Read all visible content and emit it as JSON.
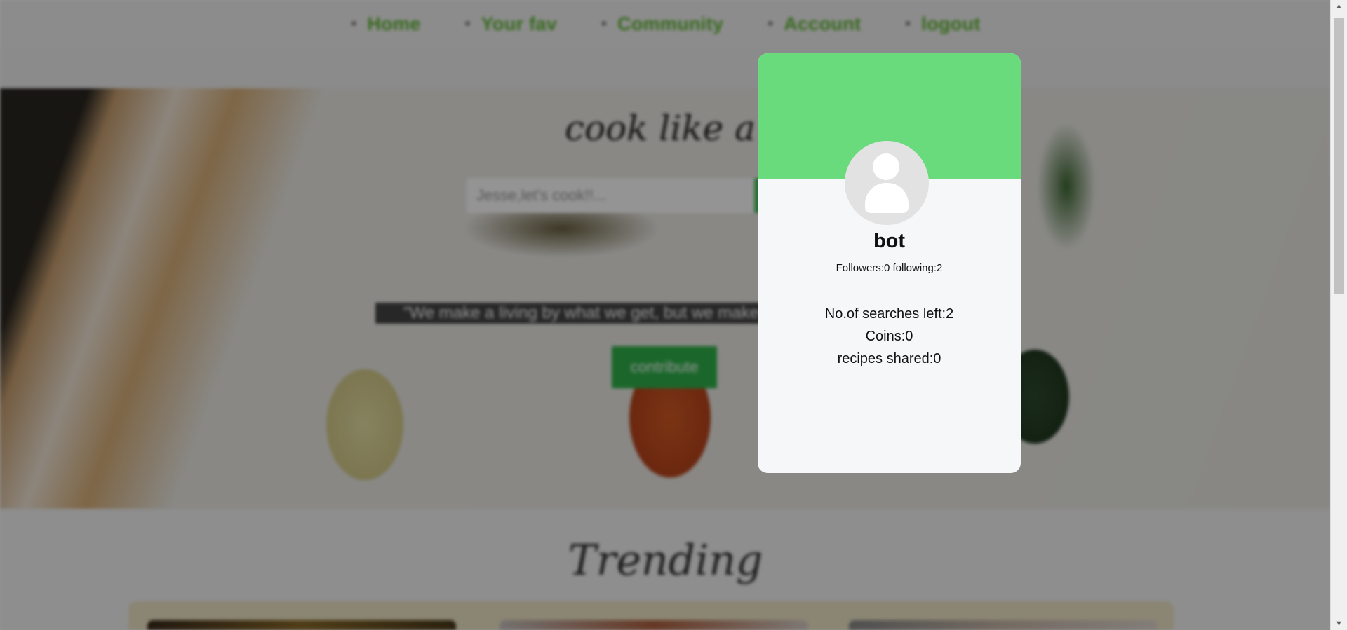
{
  "nav": {
    "items": [
      {
        "label": "Home"
      },
      {
        "label": "Your fav"
      },
      {
        "label": "Community"
      },
      {
        "label": "Account"
      },
      {
        "label": "logout"
      }
    ]
  },
  "hero": {
    "title": "cook like a pro",
    "search_placeholder": "Jesse,let's cook!!...",
    "quote": "\"We make a living by what we get, but we make a life by what we give.\"",
    "contribute_label": "contribute"
  },
  "trending": {
    "title": "Trending"
  },
  "profile": {
    "username": "bot",
    "followers_text": "Followers:0 following:2",
    "searches_left": "No.of searches left:2",
    "coins": "Coins:0",
    "recipes_shared": "recipes shared:0"
  },
  "colors": {
    "banner": "#6adb7c",
    "accent": "#5fb733",
    "button": "#2fb24b"
  }
}
